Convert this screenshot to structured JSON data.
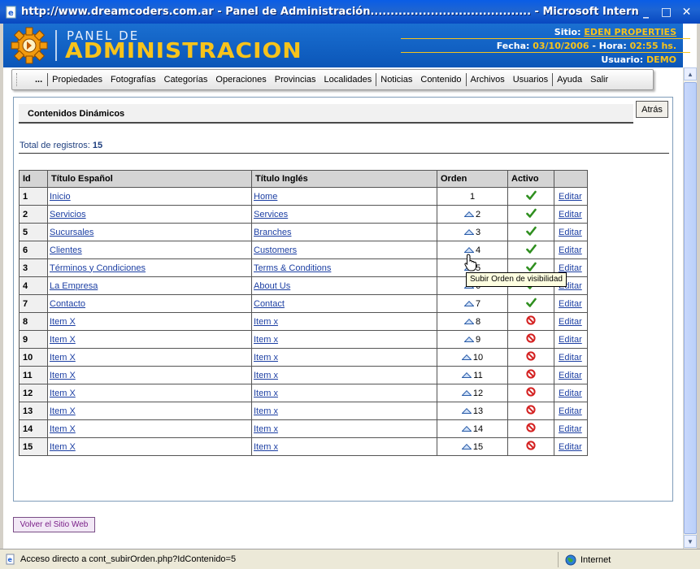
{
  "window": {
    "title": "http://www.dreamcoders.com.ar - Panel de Administración........................................ - Microsoft Internet Explorer",
    "minimize": "_",
    "maximize": "□",
    "close": "✕"
  },
  "header": {
    "logo_line1": "PANEL DE",
    "logo_line2": "ADMINISTRACION",
    "sitio_label": "Sitio:",
    "sitio_value": "EDEN PROPERTIES",
    "fecha_label": "Fecha:",
    "fecha_value": "03/10/2006",
    "hora_label": "- Hora:",
    "hora_value": "02:55 hs.",
    "usuario_label": "Usuario:",
    "usuario_value": "DEMO",
    "accent_color": "#f7c31b"
  },
  "nav": {
    "dots": "...",
    "group1": [
      "Propiedades",
      "Fotografías",
      "Categorías",
      "Operaciones",
      "Provincias",
      "Localidades"
    ],
    "group2": [
      "Noticias",
      "Contenido"
    ],
    "group3": [
      "Archivos",
      "Usuarios"
    ],
    "group4": [
      "Ayuda",
      "Salir"
    ]
  },
  "content": {
    "section_title": "Contenidos Dinámicos",
    "back_label": "Atrás",
    "total_label": "Total de registros:",
    "total_value": "15",
    "columns": [
      "Id",
      "Título Español",
      "Título Inglés",
      "Orden",
      "Activo",
      ""
    ],
    "edit_label": "Editar",
    "rows": [
      {
        "id": "1",
        "es": "Inicio",
        "en": "Home",
        "orden": "1",
        "up": false,
        "activo": true
      },
      {
        "id": "2",
        "es": "Servicios",
        "en": "Services",
        "orden": "2",
        "up": true,
        "activo": true
      },
      {
        "id": "5",
        "es": "Sucursales",
        "en": "Branches",
        "orden": "3",
        "up": true,
        "activo": true
      },
      {
        "id": "6",
        "es": "Clientes",
        "en": "Customers",
        "orden": "4",
        "up": true,
        "activo": true
      },
      {
        "id": "3",
        "es": "Términos y Condiciones",
        "en": "Terms & Conditions",
        "orden": "5",
        "up": true,
        "activo": true
      },
      {
        "id": "4",
        "es": "La Empresa",
        "en": "About Us",
        "orden": "6",
        "up": true,
        "activo": true
      },
      {
        "id": "7",
        "es": "Contacto",
        "en": "Contact",
        "orden": "7",
        "up": true,
        "activo": true
      },
      {
        "id": "8",
        "es": "Item X",
        "en": "Item x",
        "orden": "8",
        "up": true,
        "activo": false
      },
      {
        "id": "9",
        "es": "Item X",
        "en": "Item x",
        "orden": "9",
        "up": true,
        "activo": false
      },
      {
        "id": "10",
        "es": "Item X",
        "en": "Item x",
        "orden": "10",
        "up": true,
        "activo": false
      },
      {
        "id": "11",
        "es": "Item X",
        "en": "Item x",
        "orden": "11",
        "up": true,
        "activo": false
      },
      {
        "id": "12",
        "es": "Item X",
        "en": "Item x",
        "orden": "12",
        "up": true,
        "activo": false
      },
      {
        "id": "13",
        "es": "Item X",
        "en": "Item x",
        "orden": "13",
        "up": true,
        "activo": false
      },
      {
        "id": "14",
        "es": "Item X",
        "en": "Item x",
        "orden": "14",
        "up": true,
        "activo": false
      },
      {
        "id": "15",
        "es": "Item X",
        "en": "Item x",
        "orden": "15",
        "up": true,
        "activo": false
      }
    ],
    "tooltip": "Subir Orden de visibilidad",
    "volver_label": "Volver el Sitio Web",
    "colors": {
      "active": "#2f8f1f",
      "inactive": "#d42020",
      "link": "#1c3fa3"
    }
  },
  "status": {
    "text": "Acceso directo a cont_subirOrden.php?IdContenido=5",
    "zone": "Internet"
  }
}
